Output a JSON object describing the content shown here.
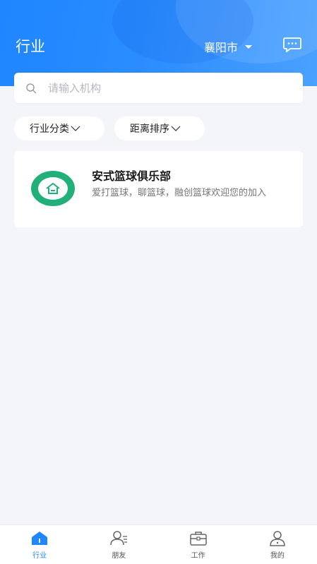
{
  "header": {
    "title": "行业",
    "city": "襄阳市",
    "message_icon": "message-icon"
  },
  "search": {
    "placeholder": "请输入机构",
    "value": ""
  },
  "filters": [
    {
      "label": "行业分类"
    },
    {
      "label": "距离排序"
    }
  ],
  "organizations": [
    {
      "name": "安式篮球俱乐部",
      "description": "爱打篮球，聊篮球，融创篮球欢迎您的加入",
      "logo_color": "#21b07a"
    }
  ],
  "tabbar": {
    "items": [
      {
        "label": "行业",
        "icon": "industry-icon",
        "active": true
      },
      {
        "label": "朋友",
        "icon": "friends-icon",
        "active": false
      },
      {
        "label": "工作",
        "icon": "briefcase-icon",
        "active": false
      },
      {
        "label": "我的",
        "icon": "profile-icon",
        "active": false
      }
    ]
  },
  "colors": {
    "accent": "#1e86ff",
    "background": "#f3f5f8"
  }
}
